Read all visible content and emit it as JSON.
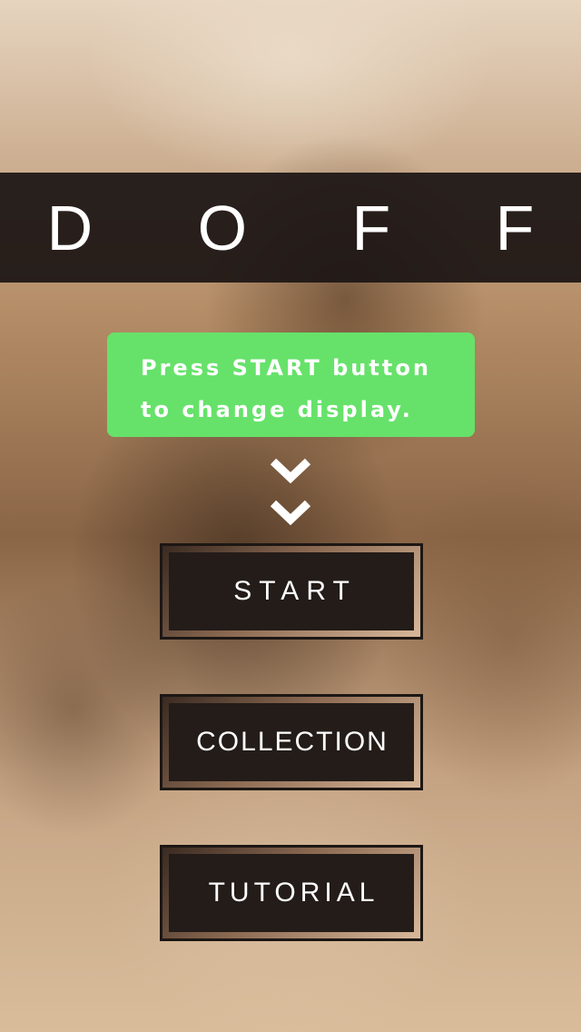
{
  "app": {
    "title": "D O F F"
  },
  "tip": {
    "line1": "Press START button",
    "line2": "to change display.",
    "color": "#66e26a"
  },
  "icons": {
    "chevrons": "double-chevron-down-icon"
  },
  "menu": {
    "start_label": "START",
    "collection_label": "COLLECTION",
    "tutorial_label": "TUTORIAL"
  }
}
